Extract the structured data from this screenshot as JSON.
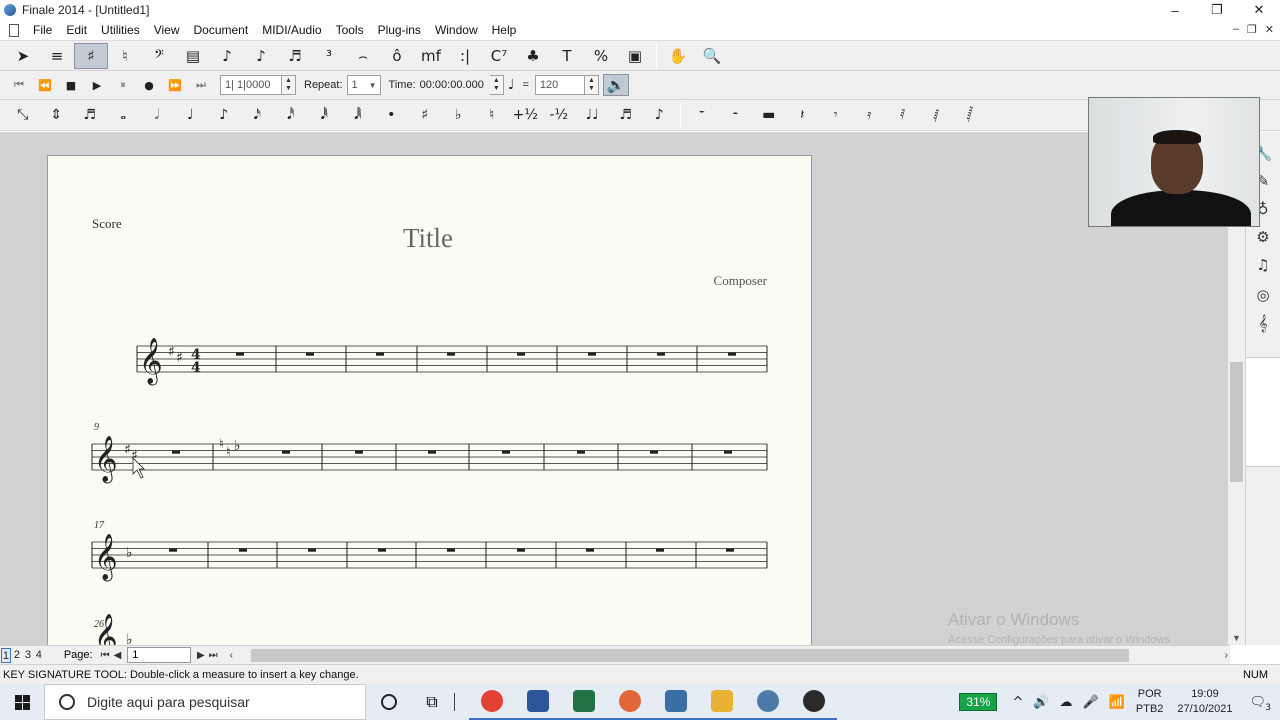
{
  "window": {
    "title": "Finale 2014 - [Untitled1]",
    "controls": [
      "–",
      "❐",
      "✕"
    ],
    "mdi_controls": [
      "–",
      "❐",
      "✕"
    ]
  },
  "menu": [
    "File",
    "Edit",
    "Utilities",
    "View",
    "Document",
    "MIDI/Audio",
    "Tools",
    "Plug-ins",
    "Window",
    "Help"
  ],
  "main_tools": [
    {
      "name": "selection-tool",
      "glyph": "➤",
      "selected": false
    },
    {
      "name": "staff-tool",
      "glyph": "≡",
      "selected": false
    },
    {
      "name": "key-signature-tool",
      "glyph": "♯",
      "selected": true
    },
    {
      "name": "time-signature-tool",
      "glyph": "♮",
      "selected": false
    },
    {
      "name": "clef-tool",
      "glyph": "𝄢",
      "selected": false
    },
    {
      "name": "measure-tool",
      "glyph": "▤",
      "selected": false
    },
    {
      "name": "simple-entry-tool",
      "glyph": "♪",
      "selected": false
    },
    {
      "name": "speedy-entry-tool",
      "glyph": "♪",
      "selected": false
    },
    {
      "name": "hyperscribe-tool",
      "glyph": "♬",
      "selected": false
    },
    {
      "name": "tuplet-tool",
      "glyph": "³",
      "selected": false
    },
    {
      "name": "smart-shape-tool",
      "glyph": "⌢",
      "selected": false
    },
    {
      "name": "articulation-tool",
      "glyph": "ô",
      "selected": false
    },
    {
      "name": "expression-tool",
      "glyph": "mf",
      "selected": false
    },
    {
      "name": "repeat-tool",
      "glyph": ":|",
      "selected": false
    },
    {
      "name": "chord-tool",
      "glyph": "C⁷",
      "selected": false
    },
    {
      "name": "lyrics-tool",
      "glyph": "♣",
      "selected": false
    },
    {
      "name": "text-tool",
      "glyph": "T",
      "selected": false
    },
    {
      "name": "resize-tool",
      "glyph": "%",
      "selected": false
    },
    {
      "name": "graphics-tool",
      "glyph": "▣",
      "selected": false
    }
  ],
  "nav_tools": [
    {
      "name": "hand-grabber-tool",
      "glyph": "✋"
    },
    {
      "name": "zoom-tool",
      "glyph": "🔍"
    }
  ],
  "playback": {
    "buttons": [
      {
        "name": "rewind-start",
        "glyph": "⏮"
      },
      {
        "name": "rewind",
        "glyph": "⏪"
      },
      {
        "name": "stop",
        "glyph": "■"
      },
      {
        "name": "play",
        "glyph": "▶"
      },
      {
        "name": "pause",
        "glyph": "⏸"
      },
      {
        "name": "record",
        "glyph": "●"
      },
      {
        "name": "fast-forward",
        "glyph": "⏩"
      },
      {
        "name": "forward-end",
        "glyph": "⏭"
      }
    ],
    "counter": "1| 1|0000",
    "repeat_label": "Repeat:",
    "repeat_value": "1",
    "time_label": "Time:",
    "time_value": "00:00:00.000",
    "tempo_equals": "=",
    "tempo_value": "120"
  },
  "entry_palette_left": [
    "⤡",
    "⇕",
    "♬",
    "𝅝",
    "𝅗𝅥",
    "♩",
    "♪",
    "𝅘𝅥𝅯",
    "𝅘𝅥𝅰",
    "𝅘𝅥𝅱",
    "𝅘𝅥𝅲",
    "•",
    "♯",
    "♭",
    "♮",
    "+½",
    "-½",
    "♩♩",
    "♬",
    "♪"
  ],
  "entry_palette_rests": [
    "𝄻",
    "𝄼",
    "▬",
    "𝄽",
    "𝄾",
    "𝄿",
    "𝅀",
    "𝅁",
    "𝅂"
  ],
  "score": {
    "label": "Score",
    "title": "Title",
    "composer": "Composer",
    "measure_numbers": [
      "9",
      "17",
      "26"
    ]
  },
  "right_palette": [
    "🔧",
    "✎",
    "♁",
    "⚙",
    "♫",
    "◎",
    "𝄞"
  ],
  "bottom": {
    "page_tabs": [
      "1",
      "2",
      "3",
      "4"
    ],
    "page_label": "Page:",
    "page_value": "1"
  },
  "status": {
    "message": "KEY SIGNATURE TOOL: Double-click a measure to insert a key change.",
    "indicator": "NUM"
  },
  "watermark": {
    "line1": "Ativar o Windows",
    "line2": "Acesse Configurações para ativar o Windows."
  },
  "taskbar": {
    "search_placeholder": "Digite aqui para pesquisar",
    "battery": "31%",
    "lang_top": "POR",
    "lang_bottom": "PTB2",
    "time": "19:09",
    "date": "27/10/2021",
    "notifications": "3",
    "apps": [
      {
        "name": "chrome",
        "color": "#e34133"
      },
      {
        "name": "word",
        "color": "#2b579a"
      },
      {
        "name": "excel",
        "color": "#217346"
      },
      {
        "name": "paint",
        "color": "#e2683c"
      },
      {
        "name": "calculator",
        "color": "#3a6ea5"
      },
      {
        "name": "file-explorer",
        "color": "#e8b335"
      },
      {
        "name": "finale",
        "color": "#4d7aa8"
      },
      {
        "name": "obs",
        "color": "#2a2a2a"
      }
    ]
  }
}
